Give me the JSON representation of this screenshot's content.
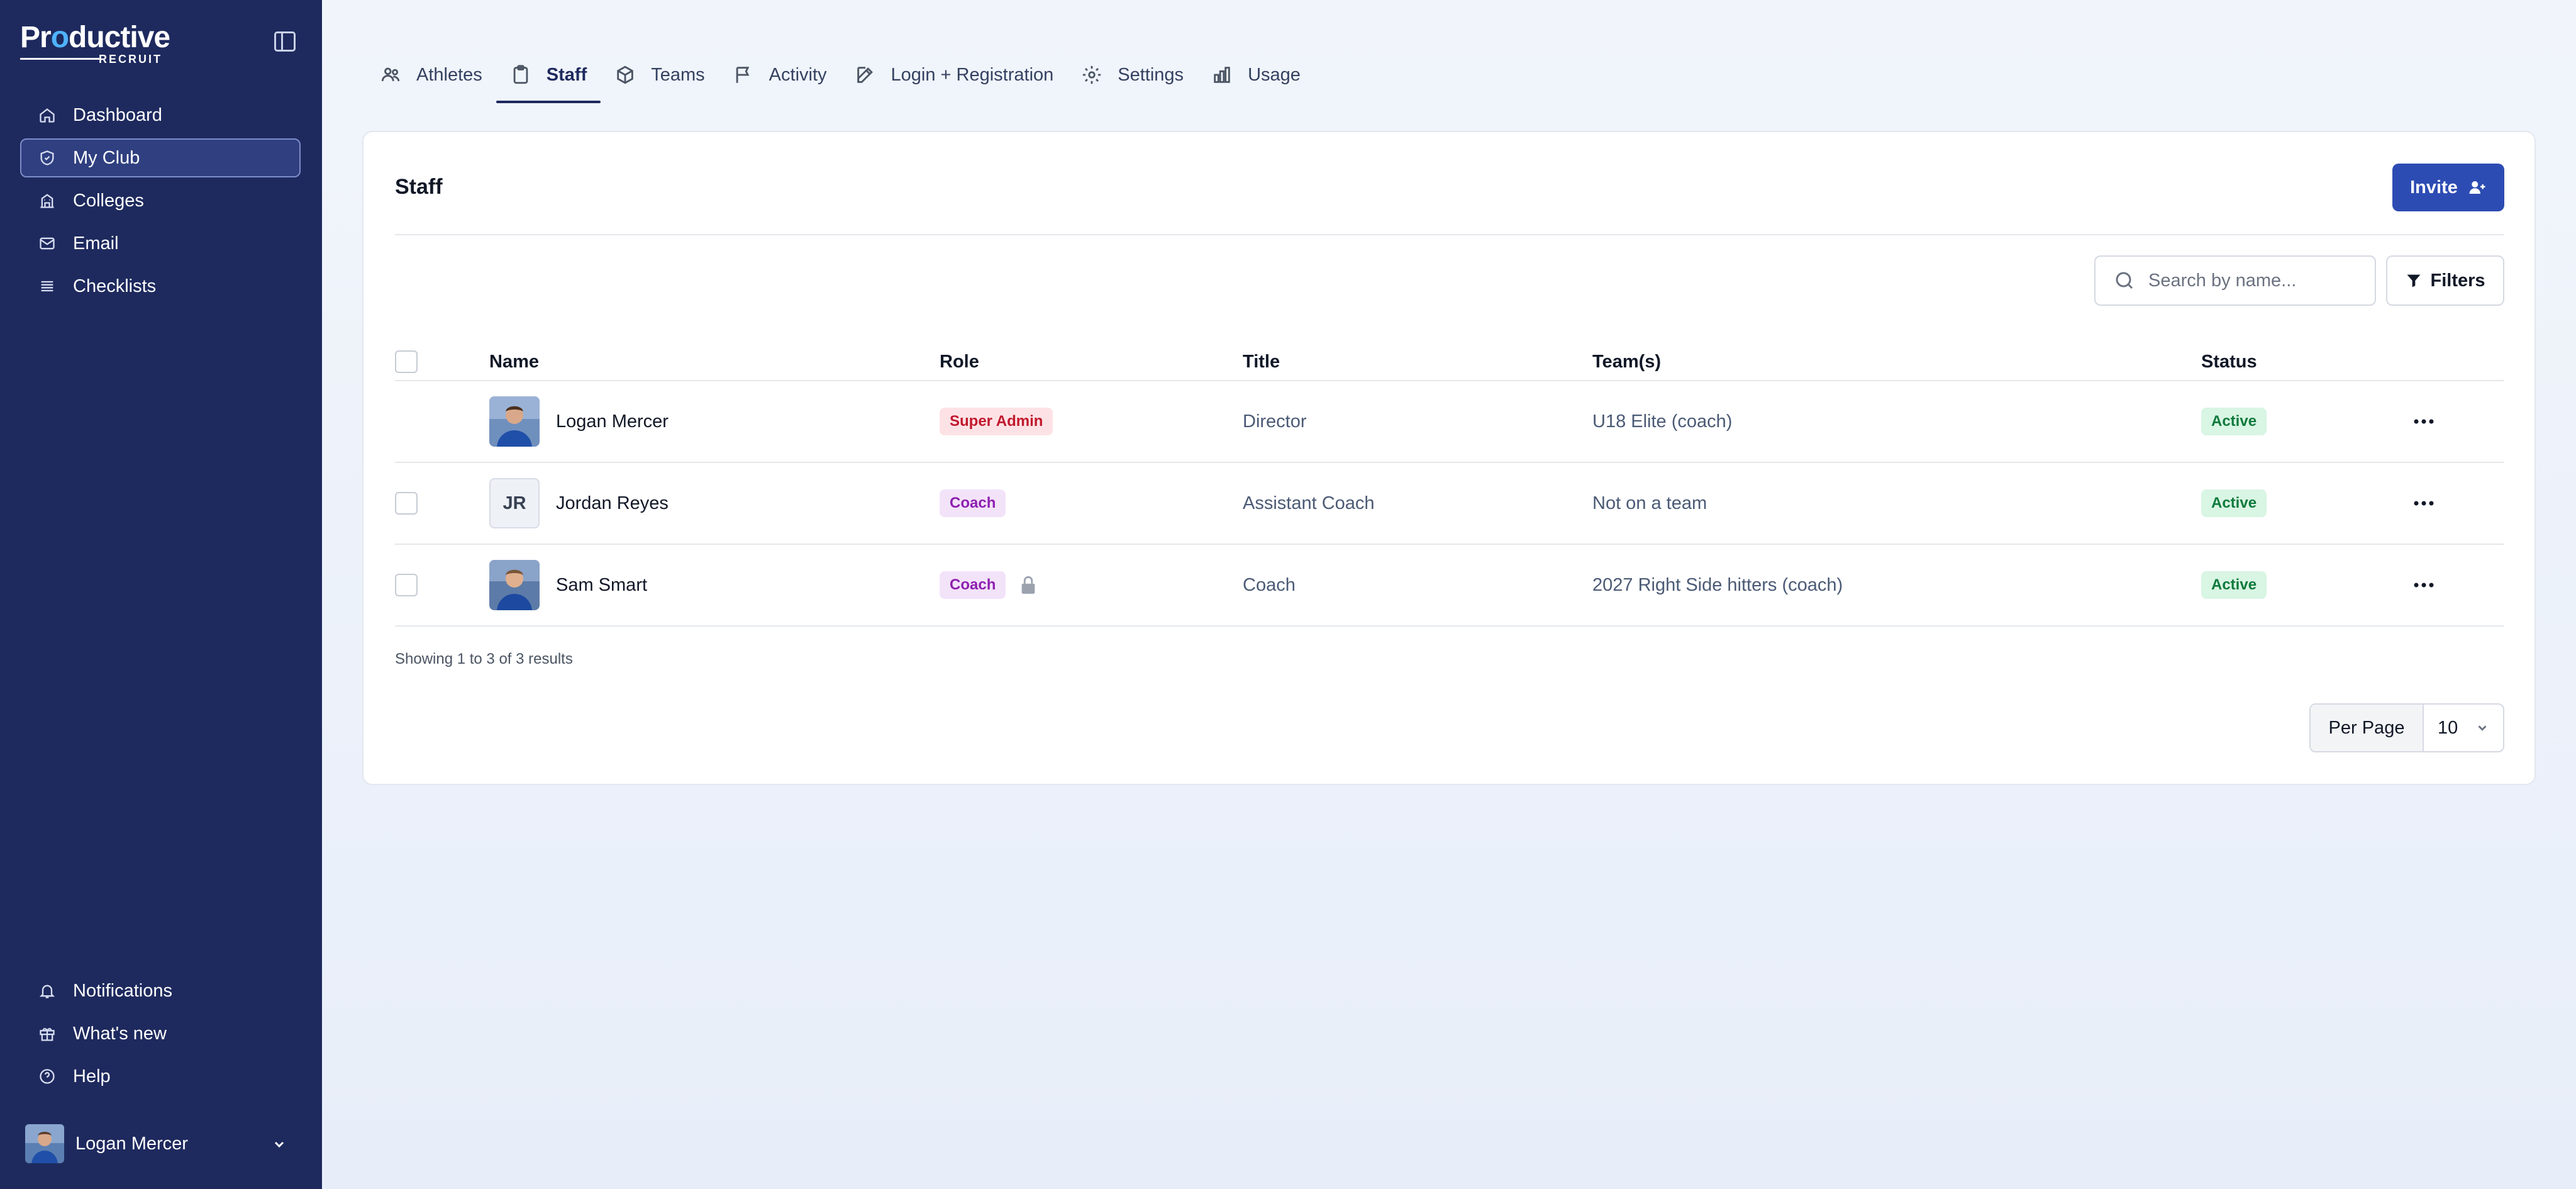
{
  "app": {
    "logo_main_1": "Pr",
    "logo_main_dot": "o",
    "logo_main_2": "ductive",
    "logo_sub": "RECRUIT"
  },
  "sidebar": {
    "items": [
      {
        "label": "Dashboard",
        "icon": "home-icon",
        "active": false
      },
      {
        "label": "My Club",
        "icon": "shield-icon",
        "active": true
      },
      {
        "label": "Colleges",
        "icon": "building-icon",
        "active": false
      },
      {
        "label": "Email",
        "icon": "mail-icon",
        "active": false
      },
      {
        "label": "Checklists",
        "icon": "list-icon",
        "active": false
      }
    ],
    "bottom_items": [
      {
        "label": "Notifications",
        "icon": "bell-icon"
      },
      {
        "label": "What's new",
        "icon": "gift-icon"
      },
      {
        "label": "Help",
        "icon": "help-icon"
      }
    ],
    "user": {
      "name": "Logan Mercer"
    }
  },
  "tabs": [
    {
      "label": "Athletes",
      "icon": "users-icon",
      "active": false
    },
    {
      "label": "Staff",
      "icon": "clipboard-icon",
      "active": true
    },
    {
      "label": "Teams",
      "icon": "cube-icon",
      "active": false
    },
    {
      "label": "Activity",
      "icon": "flag-icon",
      "active": false
    },
    {
      "label": "Login + Registration",
      "icon": "pencil-icon",
      "active": false
    },
    {
      "label": "Settings",
      "icon": "gear-icon",
      "active": false
    },
    {
      "label": "Usage",
      "icon": "bar-chart-icon",
      "active": false
    }
  ],
  "staff": {
    "title": "Staff",
    "invite_label": "Invite",
    "search_placeholder": "Search by name...",
    "filters_label": "Filters",
    "columns": {
      "name": "Name",
      "role": "Role",
      "title": "Title",
      "teams": "Team(s)",
      "status": "Status"
    },
    "rows": [
      {
        "name": "Logan Mercer",
        "initials": "",
        "role": "Super Admin",
        "title": "Director",
        "teams": "U18 Elite (coach)",
        "status": "Active"
      },
      {
        "name": "Jordan Reyes",
        "initials": "JR",
        "role": "Coach",
        "title": "Assistant Coach",
        "teams": "Not on a team",
        "status": "Active"
      },
      {
        "name": "Sam Smart",
        "initials": "",
        "role": "Coach",
        "title": "Coach",
        "teams": "2027 Right Side hitters (coach)",
        "status": "Active"
      }
    ],
    "showing": "Showing 1 to 3 of 3 results",
    "per_page_label": "Per Page",
    "per_page_value": "10"
  },
  "colors": {
    "sidebar_bg": "#1e2a5e",
    "accent": "#2d4cb3",
    "badge_super": "#c0182d",
    "badge_coach": "#8d1fb0",
    "badge_active": "#0f7a3c"
  }
}
